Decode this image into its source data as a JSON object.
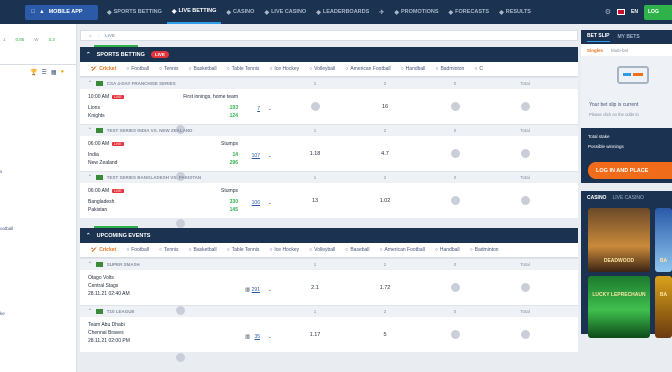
{
  "topnav": {
    "mobile_app": "MOBILE APP",
    "items": [
      {
        "label": "SPORTS BETTING",
        "icon": "trophy-icon"
      },
      {
        "label": "LIVE BETTING",
        "icon": "live-icon"
      },
      {
        "label": "CASINO",
        "icon": "dice-icon"
      },
      {
        "label": "LIVE CASINO",
        "icon": "cards-icon"
      },
      {
        "label": "LEADERBOARDS",
        "icon": "leaderboard-icon"
      },
      {
        "label": "",
        "icon": "aviator-icon"
      },
      {
        "label": "PROMOTIONS",
        "icon": "gift-icon"
      },
      {
        "label": "FORECASTS",
        "icon": "forecast-icon"
      },
      {
        "label": "RESULTS",
        "icon": "results-icon"
      }
    ],
    "lang": "EN",
    "login_label": "LOG"
  },
  "leftbar": {
    "odds_1": "0.85",
    "odds_2": "3.3",
    "sports": [
      "s",
      "ootball",
      "ke"
    ]
  },
  "crumbs": {
    "home": "⌂",
    "current": "LIVE"
  },
  "live_section": {
    "title": "SPORTS BETTING",
    "badge": "LIVE",
    "tabs": [
      "Cricket",
      "Football",
      "Tennis",
      "Basketball",
      "Table Tennis",
      "Ice Hockey",
      "Volleyball",
      "American Football",
      "Handball",
      "Badminton",
      "C"
    ],
    "col_headers": [
      "1",
      "2",
      "0",
      "Total",
      "0"
    ],
    "leagues": [
      {
        "name": "CSA 4-DAY FRANCHISE SERIES",
        "match": {
          "time": "10:00 AM",
          "info": "First innings, home team",
          "team1": "Lions",
          "team2": "Knights",
          "score1": "193",
          "score2": "124",
          "more": "7",
          "odd1": "",
          "odd2": "16"
        }
      },
      {
        "name": "TEST SERIES INDIA VS. NEW ZEALAND",
        "match": {
          "time": "06:00 AM",
          "info": "Stumps",
          "team1": "India",
          "team2": "New Zealand",
          "score1": "14",
          "score2": "296",
          "more": "107",
          "odd1": "1.18",
          "odd2": "4.7"
        }
      },
      {
        "name": "TEST SERIES BANGLADESH VS. PAKISTAN",
        "match": {
          "time": "06:00 AM",
          "info": "Stumps",
          "team1": "Bangladesh",
          "team2": "Pakistan",
          "score1": "330",
          "score2": "145",
          "more": "106",
          "odd1": "13",
          "odd2": "1.02"
        }
      }
    ]
  },
  "upcoming_section": {
    "title": "UPCOMING EVENTS",
    "tabs": [
      "Cricket",
      "Football",
      "Tennis",
      "Basketball",
      "Table Tennis",
      "Ice Hockey",
      "Volleyball",
      "Baseball",
      "American Football",
      "Handball",
      "Badminton"
    ],
    "col_headers": [
      "1",
      "2",
      "0",
      "Total",
      "0"
    ],
    "leagues": [
      {
        "name": "SUPER SMASH",
        "match": {
          "team1": "Otago Volts",
          "team2": "Central Stags",
          "time": "28.11.21 02:40 AM",
          "more": "291",
          "odd1": "2.1",
          "odd2": "1.72"
        }
      },
      {
        "name": "T10 LEAGUE",
        "match": {
          "team1": "Team Abu Dhabi",
          "team2": "Chennai Braves",
          "time": "28.11.21 02:00 PM",
          "more": "35",
          "odd1": "1.17",
          "odd2": "5"
        }
      }
    ]
  },
  "betslip": {
    "tab_active": "BET SLIP",
    "tab_other": "MY BETS",
    "type_active": "Singles",
    "type_other": "Multi-bet",
    "empty_text": "Your bet slip is current",
    "hint": "Please click on the odds to",
    "total_stake": "Total stake",
    "possible_winnings": "Possible winnings",
    "login_place": "LOG IN AND PLACE"
  },
  "casino": {
    "tab_active": "CASINO",
    "tab_other": "LIVE CASINO",
    "games": [
      "DEADWOOD",
      "BA",
      "LUCKY LEPRECHAUN",
      "BA"
    ]
  },
  "colors": {
    "nav_bg": "#1b3251",
    "accent_green": "#2fb24a",
    "accent_orange": "#e8731c",
    "live_red": "#e5333b"
  }
}
